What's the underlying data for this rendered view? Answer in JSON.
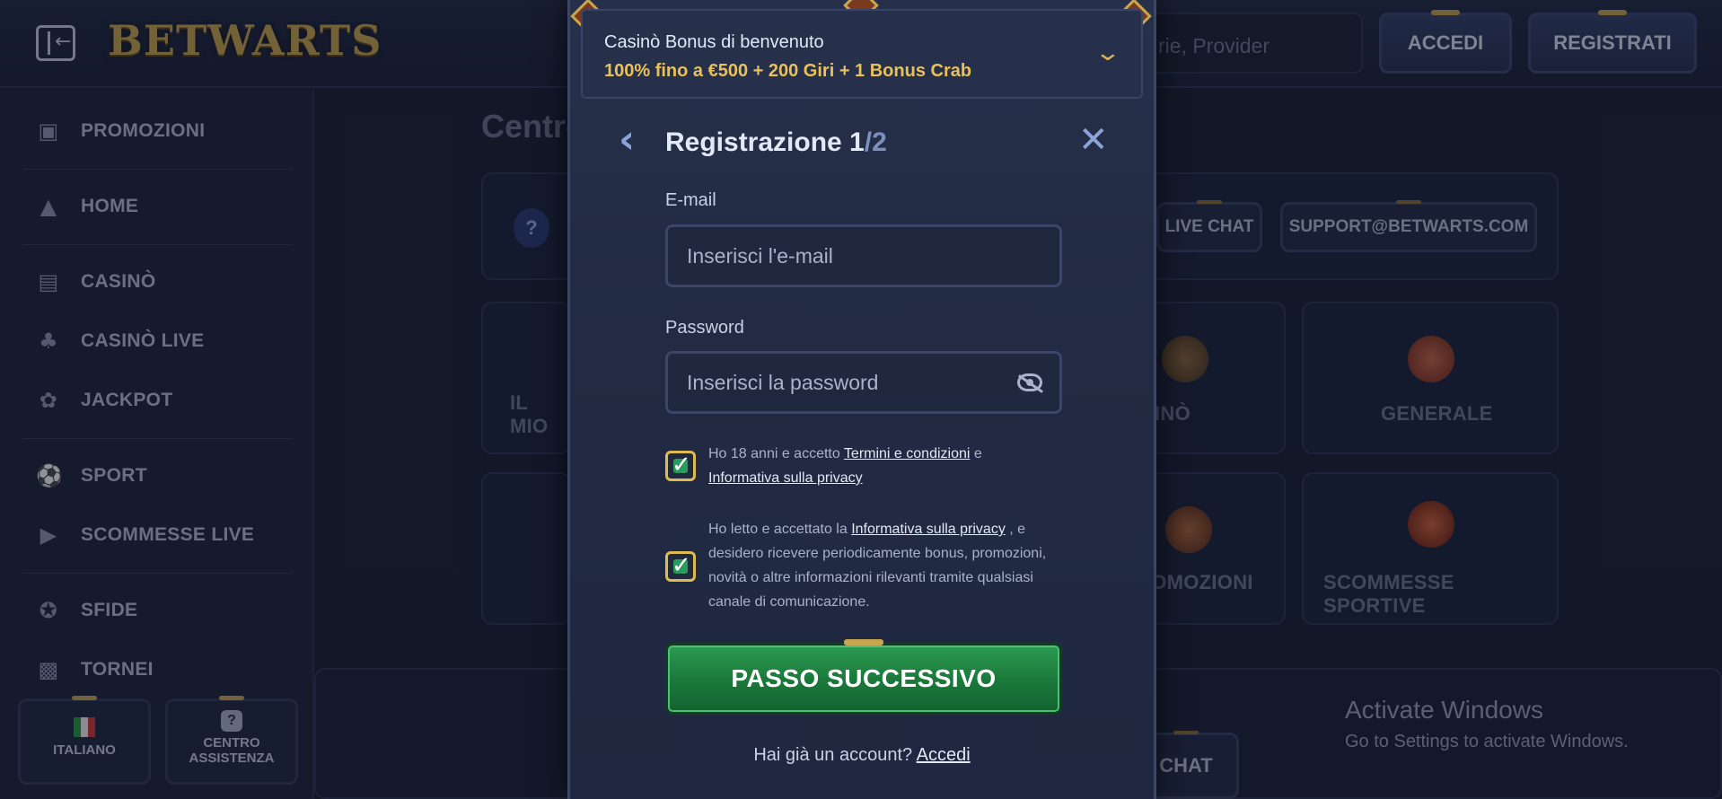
{
  "header": {
    "logo_text": "BETWARTS",
    "search_placeholder": "rie, Provider",
    "login_label": "ACCEDI",
    "register_label": "REGISTRATI"
  },
  "sidebar": {
    "items": [
      {
        "label": "PROMOZIONI",
        "icon": "gift-box-icon"
      },
      {
        "label": "HOME",
        "icon": "wizard-hat-icon"
      },
      {
        "label": "CASINÒ",
        "icon": "slot-machine-icon"
      },
      {
        "label": "CASINÒ LIVE",
        "icon": "playing-cards-icon"
      },
      {
        "label": "JACKPOT",
        "icon": "clover-icon"
      },
      {
        "label": "SPORT",
        "icon": "soccer-ball-icon"
      },
      {
        "label": "SCOMMESSE LIVE",
        "icon": "live-play-icon"
      },
      {
        "label": "SFIDE",
        "icon": "medal-icon"
      },
      {
        "label": "TORNEI",
        "icon": "podium-icon"
      }
    ],
    "language_label": "ITALIANO",
    "help_label_1": "CENTRO",
    "help_label_2": "ASSISTENZA"
  },
  "background": {
    "title": "Centro",
    "live_chat_label": "LIVE CHAT",
    "support_email": "SUPPORT@BETWARTS.COM",
    "tiles": [
      "IL MIO",
      "INÒ",
      "GENERALE",
      "ROMOZIONI",
      "SCOMMESSE SPORTIVE"
    ],
    "bottom_chat_label": "CHAT"
  },
  "modal": {
    "bonus_title": "Casinò Bonus di benvenuto",
    "bonus_desc": "100% fino a €500 + 200 Giri + 1 Bonus Crab",
    "title": "Registrazione 1",
    "step_suffix": "/2",
    "email_label": "E-mail",
    "email_placeholder": "Inserisci l'e-mail",
    "password_label": "Password",
    "password_placeholder": "Inserisci la password",
    "consent1_prefix": "Ho 18 anni e accetto ",
    "consent1_link1": "Termini e condizioni",
    "consent1_mid": " e",
    "consent1_link2": "Informativa sulla privacy",
    "consent2_prefix": "Ho letto e accettato la ",
    "consent2_link": "Informativa sulla privacy",
    "consent2_suffix": " , e desidero ricevere periodicamente bonus, promozioni, novità o altre informazioni rilevanti tramite qualsiasi canale di comunicazione.",
    "next_button": "PASSO SUCCESSIVO",
    "have_account": "Hai già un account?",
    "login_link": "Accedi"
  },
  "os_notice": {
    "title": "Activate Windows",
    "subtitle": "Go to Settings to activate Windows."
  },
  "colors": {
    "accent_gold": "#c8a64f",
    "button_green": "#1b7a3b",
    "background": "#1a2236"
  }
}
